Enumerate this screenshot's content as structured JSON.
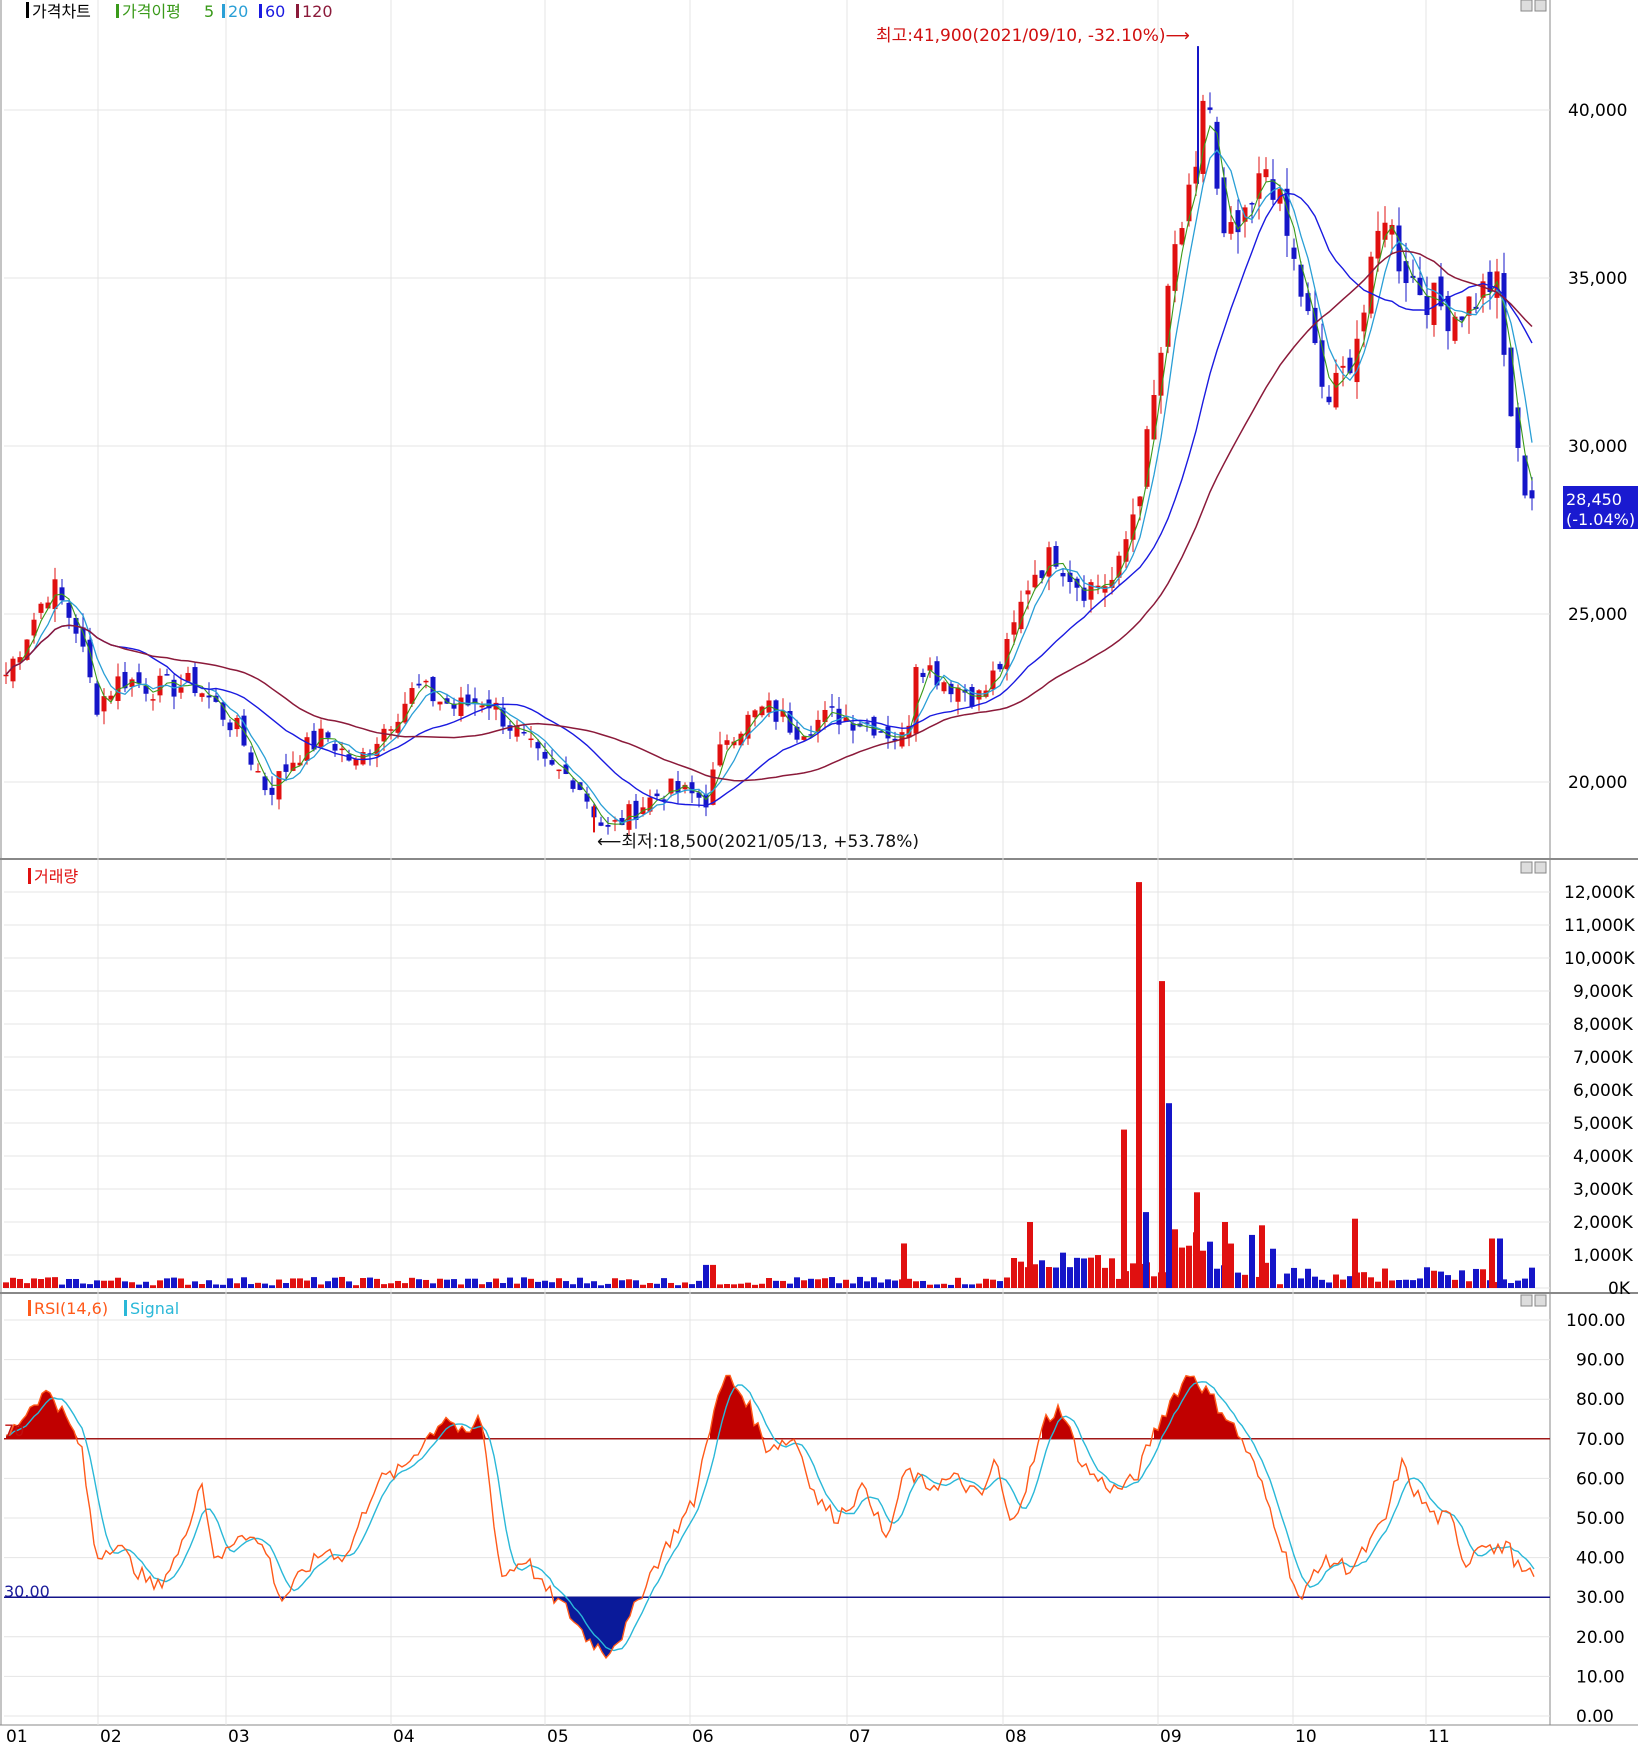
{
  "price_panel": {
    "legend": {
      "title": "가격차트",
      "ma_label": "가격이평",
      "ma_periods": [
        "5",
        "20",
        "60",
        "120"
      ],
      "ma_colors": [
        "#3a9a1a",
        "#2a9fd6",
        "#1a1ae0",
        "#8b1a3a"
      ]
    },
    "y_ticks": [
      "20,000",
      "25,000",
      "30,000",
      "35,000",
      "40,000"
    ],
    "high_annotation": "최고:41,900(2021/09/10, -32.10%)⟶",
    "low_annotation": "⟵최저:18,500(2021/05/13, +53.78%)",
    "current_price": "28,450",
    "current_change": "(-1.04%)"
  },
  "volume_panel": {
    "title": "거래량",
    "y_ticks": [
      "0K",
      "1,000K",
      "2,000K",
      "3,000K",
      "4,000K",
      "5,000K",
      "6,000K",
      "7,000K",
      "8,000K",
      "9,000K",
      "10,000K",
      "11,000K",
      "12,000K"
    ]
  },
  "rsi_panel": {
    "title": "RSI(14,6)",
    "signal_label": "Signal",
    "y_ticks": [
      "0.00",
      "10.00",
      "20.00",
      "30.00",
      "40.00",
      "50.00",
      "60.00",
      "70.00",
      "80.00",
      "90.00",
      "100.00"
    ],
    "upper_line_label": "70",
    "lower_line_label": "30.00"
  },
  "x_axis": {
    "months": [
      "01",
      "02",
      "03",
      "04",
      "05",
      "06",
      "07",
      "08",
      "09",
      "10",
      "11"
    ]
  },
  "colors": {
    "up": "#e01010",
    "down": "#1515c8",
    "rsi": "#ff5a1a",
    "signal": "#2ab8d8",
    "overbought_fill": "#c00000",
    "oversold_fill": "#0a1a9a",
    "grid": "#e4e4e4",
    "panel_border": "#888888"
  },
  "chart_data": [
    {
      "type": "candlestick",
      "title": "가격차트",
      "ylim": [
        18000,
        43000
      ],
      "series": [
        {
          "name": "가격",
          "points": [
            {
              "x": "01",
              "close": 23200
            },
            {
              "x": "01",
              "close": 24900
            },
            {
              "x": "01",
              "close": 26000
            },
            {
              "x": "02",
              "close": 22500
            },
            {
              "x": "02",
              "close": 23400
            },
            {
              "x": "02",
              "close": 22800
            },
            {
              "x": "03",
              "close": 21000
            },
            {
              "x": "03",
              "close": 19600
            },
            {
              "x": "03",
              "close": 21500
            },
            {
              "x": "04",
              "close": 20700
            },
            {
              "x": "04",
              "close": 22900
            },
            {
              "x": "04",
              "close": 22000
            },
            {
              "x": "05",
              "close": 20300
            },
            {
              "x": "05",
              "close": 18500
            },
            {
              "x": "05",
              "close": 19900
            },
            {
              "x": "06",
              "close": 21700
            },
            {
              "x": "06",
              "close": 22200
            },
            {
              "x": "06",
              "close": 21600
            },
            {
              "x": "07",
              "close": 21500
            },
            {
              "x": "07",
              "close": 23800
            },
            {
              "x": "07",
              "close": 22300
            },
            {
              "x": "08",
              "close": 26500
            },
            {
              "x": "08",
              "close": 27300
            },
            {
              "x": "08",
              "close": 26400
            },
            {
              "x": "09",
              "close": 37000
            },
            {
              "x": "09",
              "close": 41900
            },
            {
              "x": "09",
              "close": 36800
            },
            {
              "x": "10",
              "close": 31000
            },
            {
              "x": "10",
              "close": 33200
            },
            {
              "x": "10",
              "close": 35800
            },
            {
              "x": "11",
              "close": 33800
            },
            {
              "x": "11",
              "close": 34600
            },
            {
              "x": "11",
              "close": 28450
            }
          ]
        }
      ],
      "moving_averages": [
        "5",
        "20",
        "60",
        "120"
      ]
    },
    {
      "type": "bar",
      "title": "거래량",
      "ylim": [
        0,
        12000
      ],
      "unit": "K",
      "categories": [
        "01",
        "02",
        "03",
        "04",
        "05",
        "06",
        "07",
        "08",
        "09",
        "10",
        "11"
      ],
      "series": [
        {
          "name": "거래량",
          "values": [
            380,
            190,
            170,
            230,
            120,
            380,
            260,
            750,
            2000,
            420,
            380
          ]
        }
      ],
      "notable": [
        {
          "x": "09",
          "value": 12300
        },
        {
          "x": "09",
          "value": 9300
        },
        {
          "x": "09",
          "value": 5600
        }
      ]
    },
    {
      "type": "line",
      "title": "RSI(14,6)",
      "ylim": [
        0,
        100
      ],
      "x": [
        "01",
        "02",
        "03",
        "04",
        "05",
        "06",
        "07",
        "08",
        "09",
        "10",
        "11"
      ],
      "series": [
        {
          "name": "RSI(14,6)",
          "values": [
            77,
            40,
            30,
            68,
            16,
            85,
            52,
            76,
            86,
            30,
            46
          ]
        },
        {
          "name": "Signal",
          "values": [
            72,
            46,
            35,
            63,
            22,
            76,
            55,
            69,
            79,
            38,
            44
          ]
        }
      ],
      "reference_lines": [
        70,
        30
      ]
    }
  ]
}
